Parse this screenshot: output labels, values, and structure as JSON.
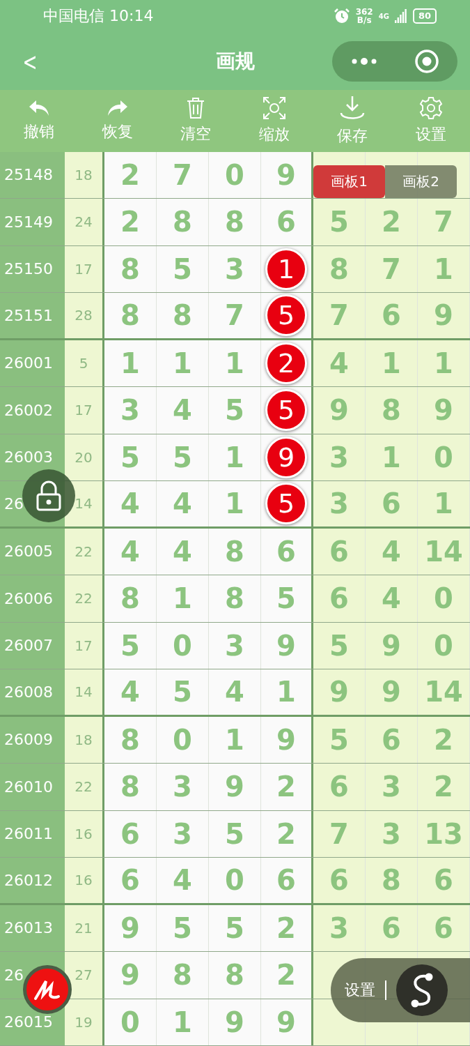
{
  "status_bar": {
    "carrier_time": "中国电信 10:14",
    "speed_value": "362",
    "speed_unit": "B/s",
    "network": "4G",
    "battery": "80"
  },
  "nav": {
    "back": "<",
    "title": "画规"
  },
  "toolbar": [
    {
      "kind": "undo",
      "label": "撤销"
    },
    {
      "kind": "redo",
      "label": "恢复"
    },
    {
      "kind": "clear",
      "label": "清空"
    },
    {
      "kind": "zoom",
      "label": "缩放"
    },
    {
      "kind": "save",
      "label": "保存"
    },
    {
      "kind": "settings",
      "label": "设置"
    }
  ],
  "board_tabs": [
    {
      "label": "画板1",
      "selected": true
    },
    {
      "label": "画板2",
      "selected": false
    }
  ],
  "rows": [
    {
      "id": "25148",
      "sum": "18",
      "digits": [
        "2",
        "7",
        "0",
        "9"
      ],
      "marked": false
    },
    {
      "id": "25149",
      "sum": "24",
      "digits": [
        "2",
        "8",
        "8",
        "6"
      ],
      "marked": false,
      "extra": [
        "5",
        "2",
        "7"
      ]
    },
    {
      "id": "25150",
      "sum": "17",
      "digits": [
        "8",
        "5",
        "3",
        "1"
      ],
      "marked": true,
      "extra": [
        "8",
        "7",
        "1"
      ]
    },
    {
      "id": "25151",
      "sum": "28",
      "digits": [
        "8",
        "8",
        "7",
        "5"
      ],
      "marked": true,
      "extra": [
        "7",
        "6",
        "9"
      ]
    },
    {
      "id": "26001",
      "sum": "5",
      "digits": [
        "1",
        "1",
        "1",
        "2"
      ],
      "marked": true,
      "extra": [
        "4",
        "1",
        "1"
      ]
    },
    {
      "id": "26002",
      "sum": "17",
      "digits": [
        "3",
        "4",
        "5",
        "5"
      ],
      "marked": true,
      "extra": [
        "9",
        "8",
        "9"
      ]
    },
    {
      "id": "26003",
      "sum": "20",
      "digits": [
        "5",
        "5",
        "1",
        "9"
      ],
      "marked": true,
      "extra": [
        "3",
        "1",
        "0"
      ]
    },
    {
      "id": "26",
      "sum": "14",
      "digits": [
        "4",
        "4",
        "1",
        "5"
      ],
      "marked": true,
      "extra": [
        "3",
        "6",
        "1"
      ]
    },
    {
      "id": "26005",
      "sum": "22",
      "digits": [
        "4",
        "4",
        "8",
        "6"
      ],
      "marked": false,
      "extra": [
        "6",
        "4",
        "14"
      ]
    },
    {
      "id": "26006",
      "sum": "22",
      "digits": [
        "8",
        "1",
        "8",
        "5"
      ],
      "marked": false,
      "extra": [
        "6",
        "4",
        "0"
      ]
    },
    {
      "id": "26007",
      "sum": "17",
      "digits": [
        "5",
        "0",
        "3",
        "9"
      ],
      "marked": false,
      "extra": [
        "5",
        "9",
        "0"
      ]
    },
    {
      "id": "26008",
      "sum": "14",
      "digits": [
        "4",
        "5",
        "4",
        "1"
      ],
      "marked": false,
      "extra": [
        "9",
        "9",
        "14"
      ]
    },
    {
      "id": "26009",
      "sum": "18",
      "digits": [
        "8",
        "0",
        "1",
        "9"
      ],
      "marked": false,
      "extra": [
        "5",
        "6",
        "2"
      ]
    },
    {
      "id": "26010",
      "sum": "22",
      "digits": [
        "8",
        "3",
        "9",
        "2"
      ],
      "marked": false,
      "extra": [
        "6",
        "3",
        "2"
      ]
    },
    {
      "id": "26011",
      "sum": "16",
      "digits": [
        "6",
        "3",
        "5",
        "2"
      ],
      "marked": false,
      "extra": [
        "7",
        "3",
        "13"
      ]
    },
    {
      "id": "26012",
      "sum": "16",
      "digits": [
        "6",
        "4",
        "0",
        "6"
      ],
      "marked": false,
      "extra": [
        "6",
        "8",
        "6"
      ]
    },
    {
      "id": "26013",
      "sum": "21",
      "digits": [
        "9",
        "5",
        "5",
        "2"
      ],
      "marked": false,
      "extra": [
        "3",
        "6",
        "6"
      ]
    },
    {
      "id": "26",
      "sum": "27",
      "digits": [
        "9",
        "8",
        "8",
        "2"
      ],
      "marked": false
    },
    {
      "id": "26015",
      "sum": "19",
      "digits": [
        "0",
        "1",
        "9",
        "9"
      ],
      "marked": false
    }
  ],
  "float_menu": {
    "label": "设置"
  }
}
